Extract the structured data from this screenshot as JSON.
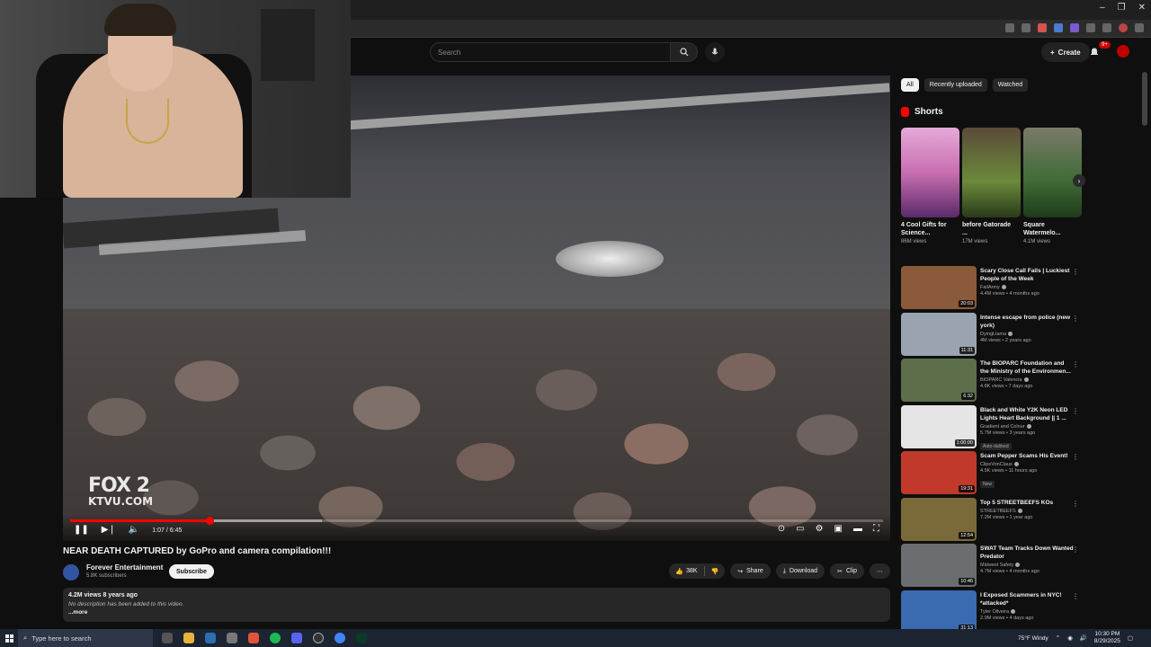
{
  "browser": {
    "window_controls": [
      "–",
      "❐",
      "✕"
    ]
  },
  "header": {
    "search_placeholder": "Search",
    "create_label": "Create",
    "notification_count": "9+"
  },
  "player": {
    "watermark_line1": "FOX 2",
    "watermark_line2": "KTVU.COM",
    "current_time": "1:07 / 6:45",
    "progress_fraction": 0.172,
    "buffer_fraction": 0.31
  },
  "video": {
    "title": "NEAR DEATH CAPTURED by GoPro and camera compilation!!!",
    "channel_name": "Forever Entertainment",
    "channel_subs": "5.8K subscribers",
    "subscribe_label": "Subscribe",
    "likes": "38K",
    "share_label": "Share",
    "download_label": "Download",
    "clip_label": "Clip",
    "views_date": "4.2M views  8 years ago",
    "description": "No description has been added to this video.",
    "more_label": "...more"
  },
  "sidebar": {
    "chips": [
      {
        "label": "All",
        "active": true
      },
      {
        "label": "Recently uploaded",
        "active": false
      },
      {
        "label": "Watched",
        "active": false
      }
    ],
    "shorts_title": "Shorts",
    "shorts": [
      {
        "title": "4 Cool Gifts for Science...",
        "views": "86M views",
        "color": "#c86fb0"
      },
      {
        "title": "before Gatorade ...",
        "views": "17M views",
        "color": "#6b8a3a"
      },
      {
        "title": "Square Watermelo...",
        "views": "4.1M views",
        "color": "#3f6b36"
      }
    ],
    "recommended": [
      {
        "title": "Scary Close Call Fails | Luckiest People of the Week",
        "channel": "FailArmy",
        "stats": "4.4M views • 4 months ago",
        "duration": "20:03",
        "color": "#8a5a3a",
        "badge": ""
      },
      {
        "title": "Intense escape from police (new york)",
        "channel": "DyingLlama",
        "stats": "4M views • 2 years ago",
        "duration": "11:31",
        "color": "#9aa3b0",
        "badge": ""
      },
      {
        "title": "The BIOPARC Foundation and the Ministry of the Environmen...",
        "channel": "BIOPARC Valencia",
        "stats": "4.8K views • 7 days ago",
        "duration": "6:32",
        "color": "#5c6e4a",
        "badge": ""
      },
      {
        "title": "Black and White Y2K Neon LED Lights Heart Background || 1 ...",
        "channel": "Gradient and Colour",
        "stats": "5.7M views • 3 years ago",
        "duration": "1:00:00",
        "color": "#e5e5e5",
        "badge": "Auto-dubbed"
      },
      {
        "title": "Scam Pepper Scams His Event!",
        "channel": "ClipsVonClaus",
        "stats": "4.5K views • 11 hours ago",
        "duration": "19:31",
        "color": "#c0392b",
        "badge": "New"
      },
      {
        "title": "Top 5 STREETBEEFS KOs",
        "channel": "STREETBEEFS",
        "stats": "7.2M views • 1 year ago",
        "duration": "12:54",
        "color": "#7a6a3a",
        "badge": ""
      },
      {
        "title": "SWAT Team Tracks Down Wanted Predator",
        "channel": "Midwest Safety",
        "stats": "4.7M views • 4 months ago",
        "duration": "10:46",
        "color": "#6a6e70",
        "badge": ""
      },
      {
        "title": "I Exposed Scammers in NYC! *attacked*",
        "channel": "Tyler Oliveira",
        "stats": "2.9M views • 4 days ago",
        "duration": "31:13",
        "color": "#3a6ab0",
        "badge": ""
      }
    ]
  },
  "taskbar": {
    "search_placeholder": "Type here to search",
    "weather": "75°F  Windy",
    "time": "10:30 PM",
    "date": "8/29/2025"
  },
  "colors": {
    "accent_red": "#ff0000",
    "background": "#0f0f0f"
  }
}
